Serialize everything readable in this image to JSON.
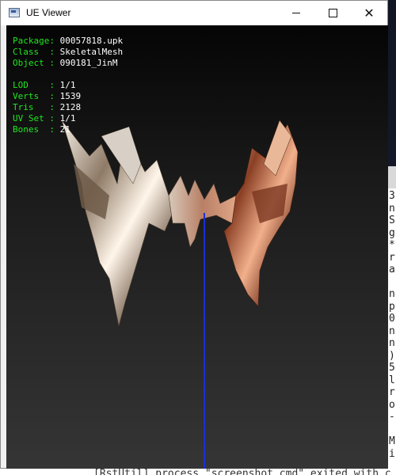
{
  "window": {
    "title": "UE Viewer",
    "minimize_glyph": "—",
    "maximize_glyph": "☐",
    "close_glyph": "✕"
  },
  "info": {
    "package_label": "Package: ",
    "package_value": "00057818.upk",
    "class_label": "Class  : ",
    "class_value": "SkeletalMesh",
    "object_label": "Object : ",
    "object_value": "090181_JinM",
    "lod_label": "LOD    : ",
    "lod_value": "1/1",
    "verts_label": "Verts  : ",
    "verts_value": "1539",
    "tris_label": "Tris   : ",
    "tris_value": "2128",
    "uvset_label": "UV Set : ",
    "uvset_value": "1/1",
    "bones_label": "Bones  : ",
    "bones_value": "21"
  },
  "background": {
    "left_char": "M",
    "console_lines": [
      "3",
      "n",
      "S",
      "g",
      "*",
      "r",
      "a",
      "",
      "n",
      "p",
      "0",
      "n",
      "n",
      ")",
      "5",
      "l",
      "r",
      "o",
      "-",
      "",
      "M",
      "i"
    ],
    "console_bottom": "[RstUtil] process \"screenshot.cmd\" exited with c"
  },
  "colors": {
    "info_label": "#1fe81f",
    "info_value": "#ffffff",
    "axis": "#1b2fd6"
  }
}
